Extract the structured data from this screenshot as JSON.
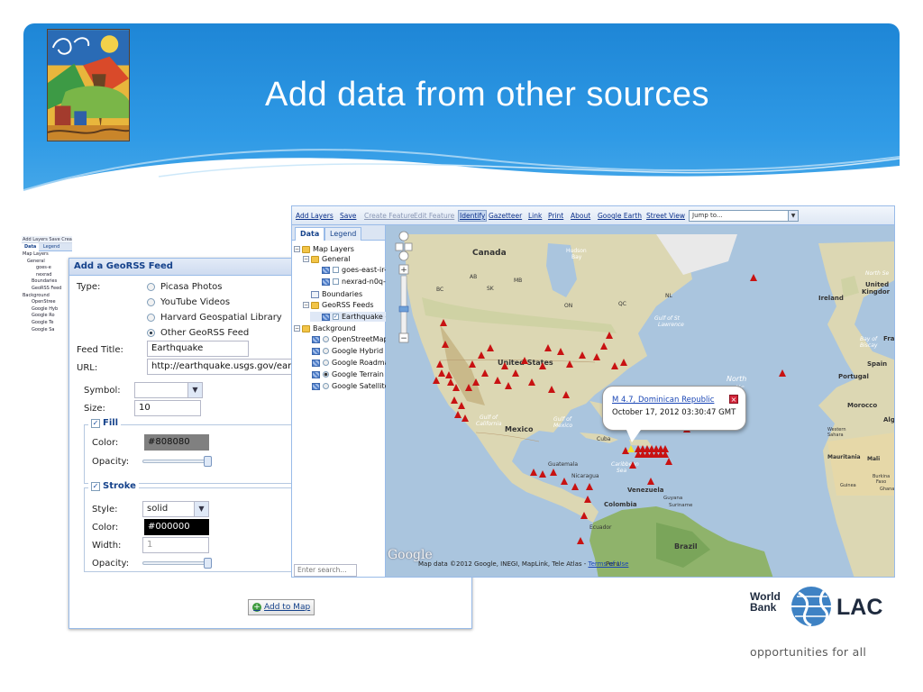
{
  "slide": {
    "title": "Add data from other sources"
  },
  "thumbnail": {
    "toolbar": "Add Layers  Save  Create Feature  Edit Feature  Identify  Gazetteer  Link  Print  About  Google Earth  Street View  Jump to...",
    "tabs": [
      "Data",
      "Legend"
    ],
    "rows": [
      "Map Layers",
      "General",
      "goes-e",
      "nexrad",
      "Boundaries",
      "GeoRSS Feed",
      "Background",
      "OpenStree",
      "Google Hyb",
      "Google Ro",
      "Google Te",
      "Google Sa"
    ]
  },
  "dialog": {
    "title": "Add a GeoRSS Feed",
    "type_label": "Type:",
    "type_options": [
      {
        "label": "Picasa Photos",
        "selected": false
      },
      {
        "label": "YouTube Videos",
        "selected": false
      },
      {
        "label": "Harvard Geospatial Library",
        "selected": false
      },
      {
        "label": "Other GeoRSS Feed",
        "selected": true
      }
    ],
    "feed_title_label": "Feed Title:",
    "feed_title_value": "Earthquake",
    "url_label": "URL:",
    "url_value": "http://earthquake.usgs.gov/earthqual",
    "symbol_label": "Symbol:",
    "symbol_value": "",
    "size_label": "Size:",
    "size_value": "10",
    "fill": {
      "legend": "Fill",
      "checked": true,
      "color_label": "Color:",
      "color_value": "#808080",
      "opacity_label": "Opacity:",
      "opacity": 1.0
    },
    "stroke": {
      "legend": "Stroke",
      "checked": true,
      "style_label": "Style:",
      "style_value": "solid",
      "color_label": "Color:",
      "color_value": "#000000",
      "width_label": "Width:",
      "width_placeholder": "1",
      "opacity_label": "Opacity:",
      "opacity": 1.0
    },
    "add_button": "Add to Map"
  },
  "app": {
    "toolbar": {
      "add_layers": "Add Layers",
      "save": "Save",
      "create_feature": "Create Feature",
      "edit_feature": "Edit Feature",
      "identify": "Identify",
      "gazetteer": "Gazetteer",
      "link": "Link",
      "print": "Print",
      "about": "About",
      "google_earth": "Google Earth",
      "street_view": "Street View",
      "jump_to": "Jump to..."
    },
    "tabs": {
      "data": "Data",
      "legend": "Legend"
    },
    "tree": {
      "map_layers": "Map Layers",
      "general": "General",
      "goes": "goes-east-ir-",
      "nexrad": "nexrad-n0q-9",
      "boundaries": "Boundaries",
      "georss": "GeoRSS Feeds",
      "earthquake": "Earthquake -",
      "background": "Background",
      "osm": "OpenStreetMap",
      "hybrid": "Google Hybrid",
      "roadmap": "Google Roadmap",
      "terrain": "Google Terrain",
      "satellite": "Google Satellite"
    },
    "search_placeholder": "Enter search...",
    "map": {
      "labels": {
        "canada": "Canada",
        "hudson": "Hudson",
        "bay": "Bay",
        "ab": "AB",
        "sk": "SK",
        "mb": "MB",
        "bc": "BC",
        "on": "ON",
        "qc": "QC",
        "nl": "NL",
        "gulf_st_lawrence_1": "Gulf of St",
        "gulf_st_lawrence_2": "Lawrence",
        "us": "United States",
        "mexico": "Mexico",
        "gulf_cal_1": "Gulf of",
        "gulf_cal_2": "California",
        "gulf_mex_1": "Gulf of",
        "gulf_mex_2": "Mexico",
        "cuba": "Cuba",
        "caribbean_1": "Caribbean",
        "caribbean_2": "Sea",
        "guatemala": "Guatemala",
        "nicaragua": "Nicaragua",
        "venezuela": "Venezuela",
        "colombia": "Colombia",
        "guyana": "Guyana",
        "suriname": "Suriname",
        "ecuador": "Ecuador",
        "brazil": "Brazil",
        "peru": "Peru",
        "north_1": "North",
        "north_2": "tic",
        "north_3": "n",
        "ireland": "Ireland",
        "united_kingdom_1": "United",
        "united_kingdom_2": "Kingdor",
        "north_sea": "North Se",
        "bay_biscay_1": "Bay of",
        "bay_biscay_2": "Biscay",
        "portugal": "Portugal",
        "spain": "Spain",
        "fra": "Fra",
        "morocco": "Morocco",
        "alg": "Alg",
        "western_sahara_1": "Western",
        "western_sahara_2": "Sahara",
        "mauritania": "Mauritania",
        "mali": "Mali",
        "burkina_1": "Burkina",
        "burkina_2": "Faso",
        "guinea": "Guinea",
        "ghana": "Ghana"
      },
      "popup": {
        "title": "M 4.7, Dominican Republic",
        "time": "October 17, 2012 03:30:47 GMT"
      },
      "logo": "Google",
      "attribution": "Map data ©2012 Google, INEGI, MapLink, Tele Atlas - ",
      "terms": "Terms of Use"
    }
  },
  "branding": {
    "wb_line1": "World",
    "wb_line2": "Bank",
    "lac": "LAC",
    "tagline": "opportunities for all"
  },
  "colors": {
    "banner_blue": "#2f9ae6",
    "earthquake_red": "#c81212",
    "ocean": "#aac5de",
    "land": "#dcd7b3"
  }
}
